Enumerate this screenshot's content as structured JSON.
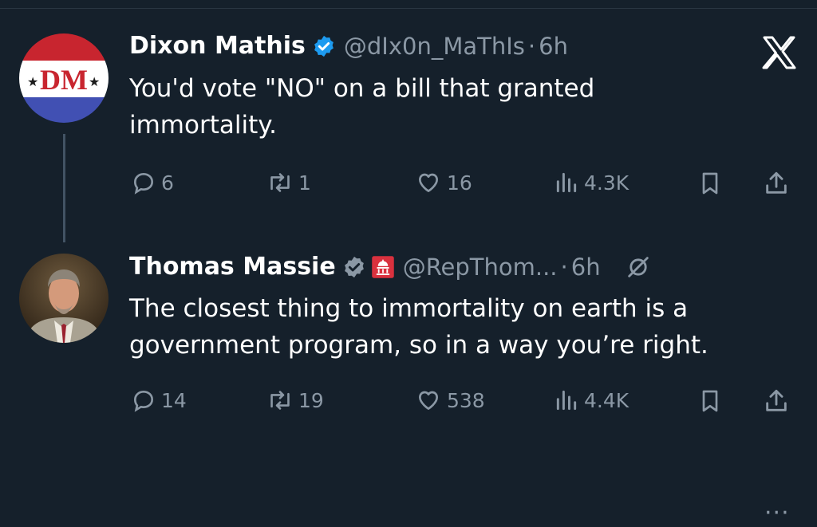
{
  "tweet1": {
    "name": "Dixon Mathis",
    "handle": "@dIx0n_MaThIs",
    "dot": "·",
    "time": "6h",
    "avatar_text": "DM",
    "text_line1": "You'd vote \"NO\" on a bill that granted",
    "text_line2": "immortality.",
    "replies": "6",
    "reposts": "1",
    "likes": "16",
    "views": "4.3K"
  },
  "tweet2": {
    "name": "Thomas Massie",
    "handle": "@RepThom...",
    "dot": "·",
    "time": "6h",
    "text_line1": "The closest thing to immortality on earth is a",
    "text_line2": "government program, so in a way you’re right.",
    "replies": "14",
    "reposts": "19",
    "likes": "538",
    "views": "4.4K",
    "more": "···"
  },
  "colors": {
    "background": "#15202b",
    "secondary_text": "#8b98a5",
    "verified": "#1d9bf0",
    "government_badge": "#d9313e"
  },
  "icons": [
    "x-logo-icon",
    "verified-badge-icon",
    "reply-icon",
    "repost-icon",
    "like-icon",
    "views-icon",
    "bookmark-icon",
    "share-icon",
    "government-badge-icon",
    "no-edit-icon",
    "more-icon"
  ]
}
